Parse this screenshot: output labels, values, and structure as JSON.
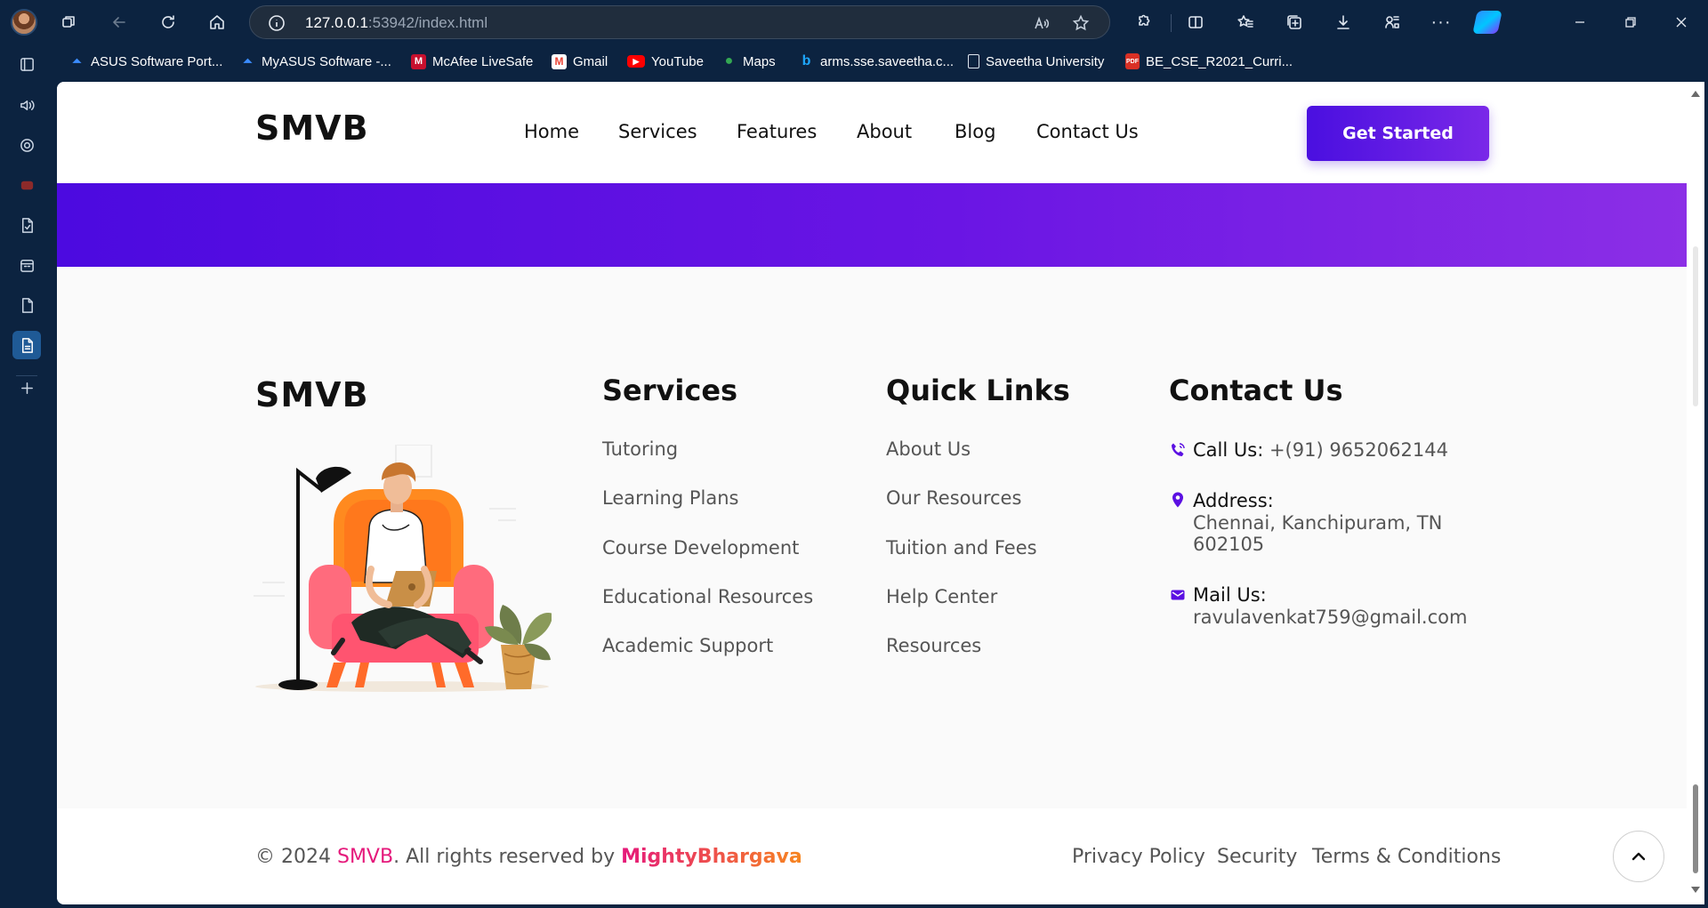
{
  "browser": {
    "url_host": "127.0.0.1",
    "url_rest": ":53942/index.html",
    "bookmarks": [
      {
        "label": "ASUS Software Port...",
        "icon": "asus-icon"
      },
      {
        "label": "MyASUS Software -...",
        "icon": "asus-icon"
      },
      {
        "label": "McAfee LiveSafe",
        "icon": "mcafee-icon"
      },
      {
        "label": "Gmail",
        "icon": "gmail-icon"
      },
      {
        "label": "YouTube",
        "icon": "youtube-icon"
      },
      {
        "label": "Maps",
        "icon": "maps-icon"
      },
      {
        "label": "arms.sse.saveetha.c...",
        "icon": "bing-icon"
      },
      {
        "label": "Saveetha University",
        "icon": "page-icon"
      },
      {
        "label": "BE_CSE_R2021_Curri...",
        "icon": "pdf-icon"
      }
    ]
  },
  "header": {
    "logo": "SMVB",
    "nav": [
      "Home",
      "Services",
      "Features",
      "About",
      "Blog",
      "Contact Us"
    ],
    "cta": "Get Started"
  },
  "footer": {
    "logo": "SMVB",
    "services": {
      "title": "Services",
      "links": [
        "Tutoring",
        "Learning Plans",
        "Course Development",
        "Educational Resources",
        "Academic Support"
      ]
    },
    "quick_links": {
      "title": "Quick Links",
      "links": [
        "About Us",
        "Our Resources",
        "Tuition and Fees",
        "Help Center",
        "Resources"
      ]
    },
    "contact": {
      "title": "Contact Us",
      "call_label": "Call Us:",
      "call_value": "+(91) 9652062144",
      "address_label": "Address:",
      "address_line1": "Chennai, Kanchipuram, TN",
      "address_line2": "602105",
      "mail_label": "Mail Us:",
      "mail_value": "ravulavenkat759@gmail.com"
    }
  },
  "bottom": {
    "copyright_prefix": "© 2024 ",
    "brand": "SMVB",
    "copyright_mid": ". All rights reserved by ",
    "author": "MightyBhargava",
    "legal": [
      "Privacy Policy",
      "Security",
      "Terms & Conditions"
    ]
  },
  "colors": {
    "accent_purple": "#5b10e2",
    "brand_pink": "#e5197b",
    "brand_orange": "#f7861f"
  }
}
